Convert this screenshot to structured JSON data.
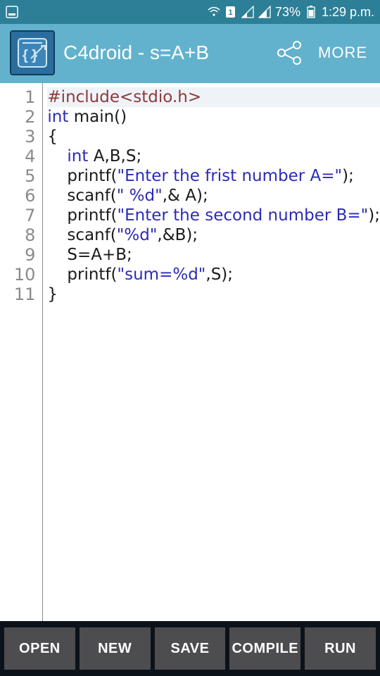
{
  "status": {
    "battery": "73%",
    "time": "1:29 p.m."
  },
  "appbar": {
    "title": "C4droid - s=A+B",
    "more_label": "MORE"
  },
  "code": {
    "lines": [
      {
        "n": "1",
        "indent": 0,
        "segs": [
          {
            "cls": "pp",
            "t": "#include<stdio.h>"
          }
        ],
        "hl": true
      },
      {
        "n": "2",
        "indent": 0,
        "segs": [
          {
            "cls": "kw",
            "t": "int"
          },
          {
            "cls": "pl",
            "t": " main()"
          }
        ]
      },
      {
        "n": "3",
        "indent": 0,
        "segs": [
          {
            "cls": "pl",
            "t": "{"
          }
        ]
      },
      {
        "n": "4",
        "indent": 1,
        "segs": [
          {
            "cls": "kw",
            "t": "int"
          },
          {
            "cls": "pl",
            "t": " A,B,S;"
          }
        ]
      },
      {
        "n": "5",
        "indent": 1,
        "segs": [
          {
            "cls": "fn",
            "t": "printf("
          },
          {
            "cls": "str",
            "t": "\"Enter the frist number A=\""
          },
          {
            "cls": "fn",
            "t": ");"
          }
        ]
      },
      {
        "n": "6",
        "indent": 1,
        "segs": [
          {
            "cls": "fn",
            "t": "scanf("
          },
          {
            "cls": "str",
            "t": "\" %d\""
          },
          {
            "cls": "fn",
            "t": ",& A);"
          }
        ]
      },
      {
        "n": "7",
        "indent": 1,
        "segs": [
          {
            "cls": "fn",
            "t": "printf("
          },
          {
            "cls": "str",
            "t": "\"Enter the second number B=\""
          },
          {
            "cls": "fn",
            "t": ");"
          }
        ]
      },
      {
        "n": "8",
        "indent": 1,
        "segs": [
          {
            "cls": "fn",
            "t": "scanf("
          },
          {
            "cls": "str",
            "t": "\"%d\""
          },
          {
            "cls": "fn",
            "t": ",&B);"
          }
        ]
      },
      {
        "n": "9",
        "indent": 1,
        "segs": [
          {
            "cls": "pl",
            "t": "S=A+B;"
          }
        ]
      },
      {
        "n": "10",
        "indent": 1,
        "segs": [
          {
            "cls": "fn",
            "t": "printf("
          },
          {
            "cls": "str",
            "t": "\"sum=%d\""
          },
          {
            "cls": "fn",
            "t": ",S);"
          }
        ]
      },
      {
        "n": "11",
        "indent": 0,
        "segs": [
          {
            "cls": "pl",
            "t": "}"
          }
        ]
      }
    ]
  },
  "toolbar": {
    "open": "OPEN",
    "new": "NEW",
    "save": "SAVE",
    "compile": "COMPILE",
    "run": "RUN"
  }
}
